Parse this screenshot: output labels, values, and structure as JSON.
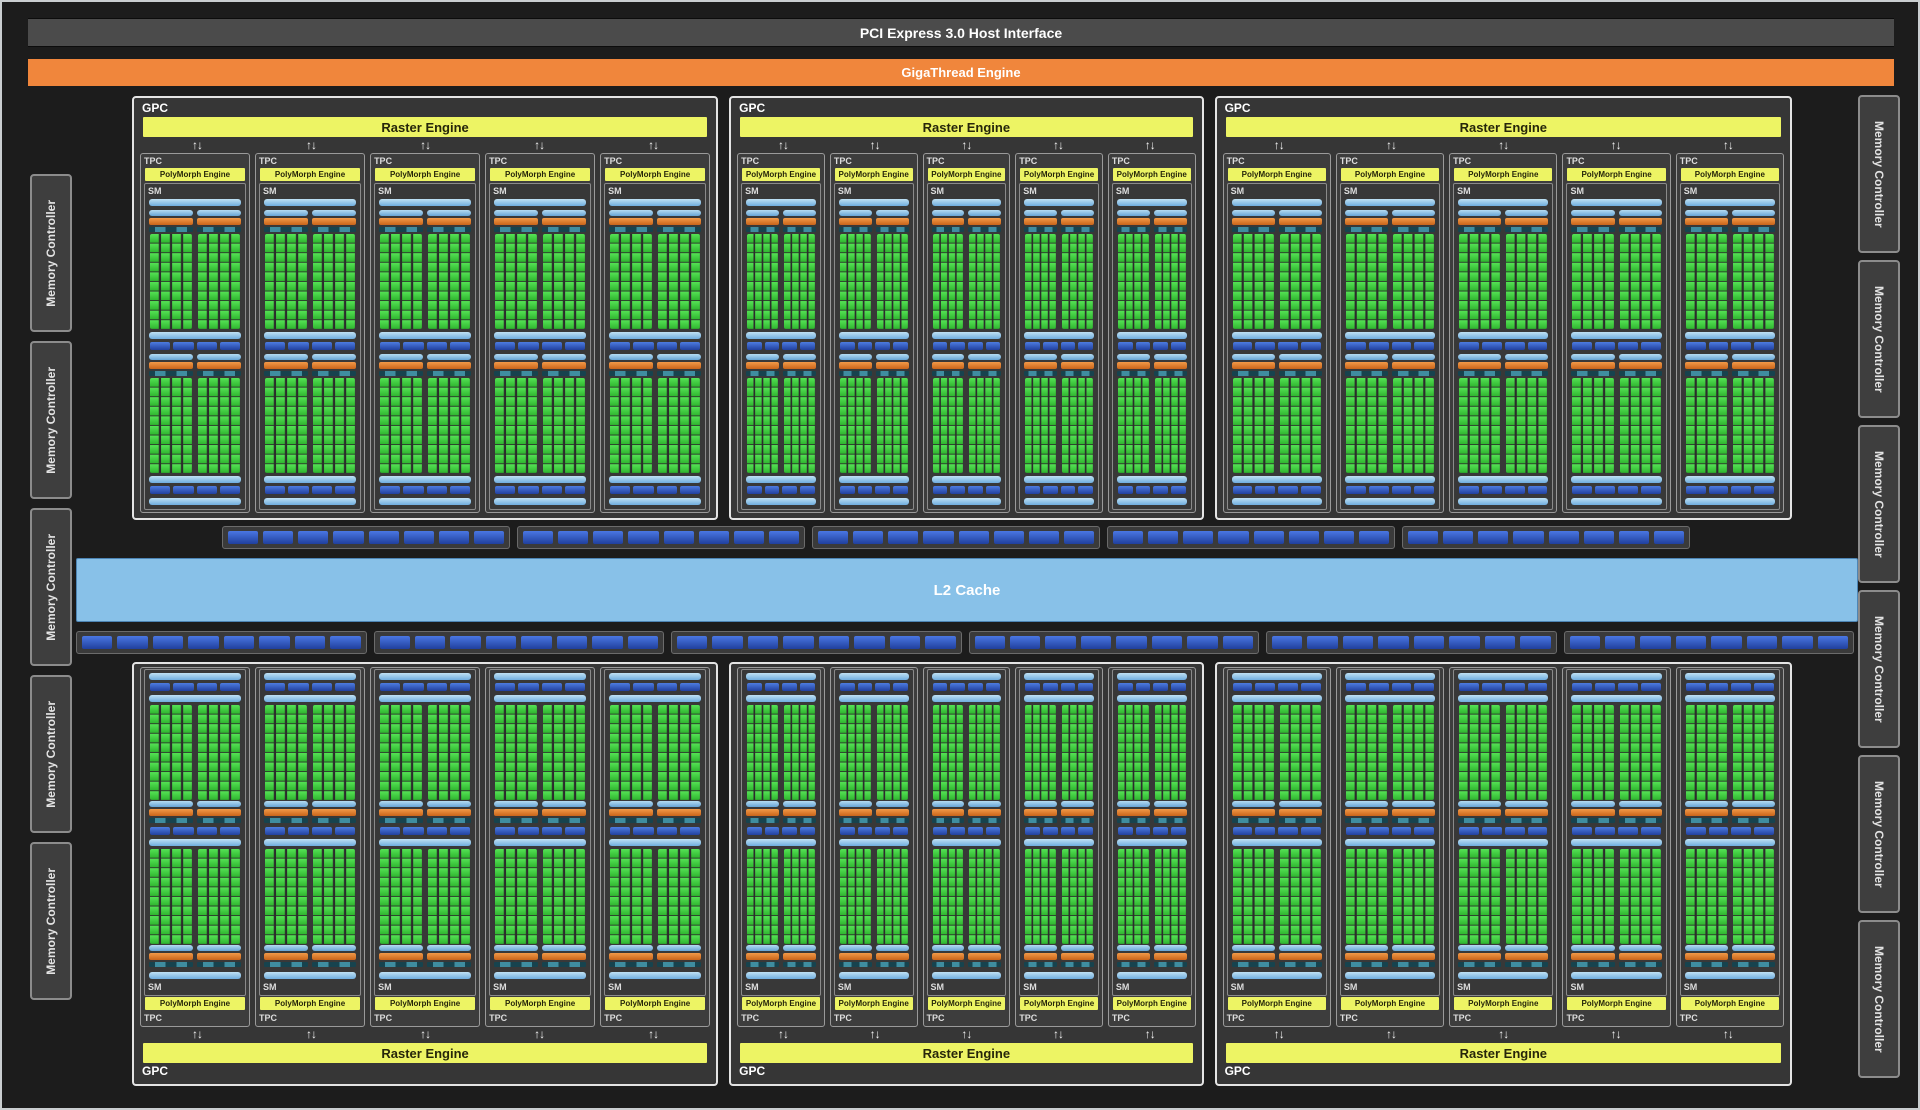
{
  "chip": {
    "host_interface": "PCI Express 3.0 Host Interface",
    "gigathread": "GigaThread Engine",
    "l2_cache": "L2 Cache",
    "memory_controller": "Memory Controller"
  },
  "labels": {
    "gpc": "GPC",
    "tpc": "TPC",
    "sm": "SM",
    "raster_engine": "Raster Engine",
    "polymorph_engine": "PolyMorph Engine"
  },
  "icons": {
    "flow_arrows": "↑↓"
  },
  "layout": {
    "top_gpcs": 3,
    "bottom_gpcs": 3,
    "tpcs_per_gpc": 5,
    "gpc_flex": [
      587,
      472,
      578
    ],
    "left_memory_controllers": 5,
    "right_memory_controllers": 6,
    "crossbar_top_groups": 5,
    "crossbar_bottom_groups": 6,
    "crossbar_blocks_per_group": 8,
    "core_grid_cols": 4,
    "core_grid_rows": 10,
    "texture_segments_per_row": 4
  },
  "colors": {
    "host_bar": "#4b4b4b",
    "gigathread": "#f0863c",
    "raster_yellow": "#edf464",
    "l2_blue": "#88c1e8",
    "lightblue_bar": "#6fadde",
    "lightblue_hi": "#bfe1f4",
    "orange_bar": "#c9641a",
    "teal_bar": "#17434e",
    "core_green": "#2fb52f",
    "core_green_hi": "#55e355",
    "crossbar_blue": "#20409e"
  }
}
